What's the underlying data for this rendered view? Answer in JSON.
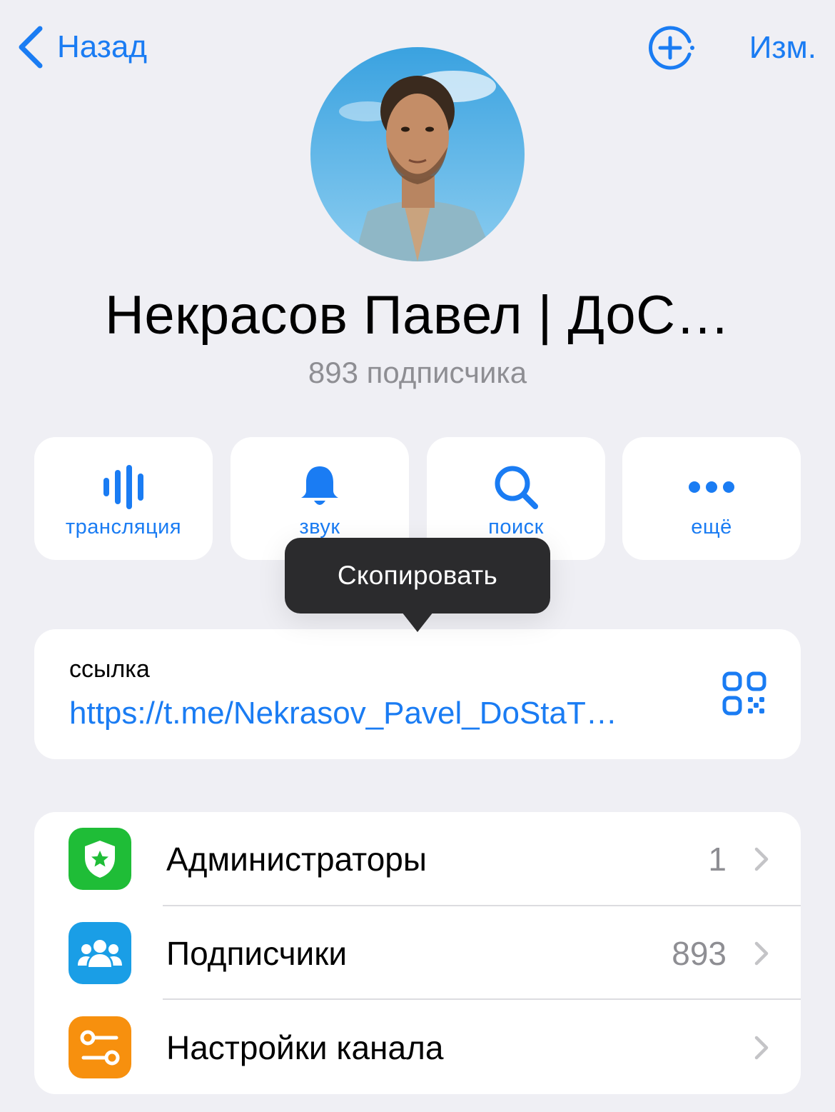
{
  "nav": {
    "back_label": "Назад",
    "edit_label": "Изм."
  },
  "channel": {
    "title": "Некрасов Павел | ДоС…",
    "subtitle": "893 подписчика"
  },
  "actions": [
    {
      "label": "трансляция",
      "icon": "voice-chat-icon"
    },
    {
      "label": "звук",
      "icon": "bell-icon"
    },
    {
      "label": "поиск",
      "icon": "search-icon"
    },
    {
      "label": "ещё",
      "icon": "more-icon"
    }
  ],
  "tooltip": {
    "label": "Скопировать"
  },
  "link": {
    "caption": "ссылка",
    "url": "https://t.me/Nekrasov_Pavel_DoStaT…"
  },
  "settings": [
    {
      "label": "Администраторы",
      "value": "1",
      "icon": "admin-shield-icon",
      "color": "#1fbd37"
    },
    {
      "label": "Подписчики",
      "value": "893",
      "icon": "subscribers-icon",
      "color": "#1a9ee6"
    },
    {
      "label": "Настройки канала",
      "value": "",
      "icon": "channel-settings-icon",
      "color": "#f7900e"
    }
  ],
  "colors": {
    "accent": "#1a7cf3",
    "background": "#efeff4",
    "secondary_text": "#8e8e93"
  }
}
